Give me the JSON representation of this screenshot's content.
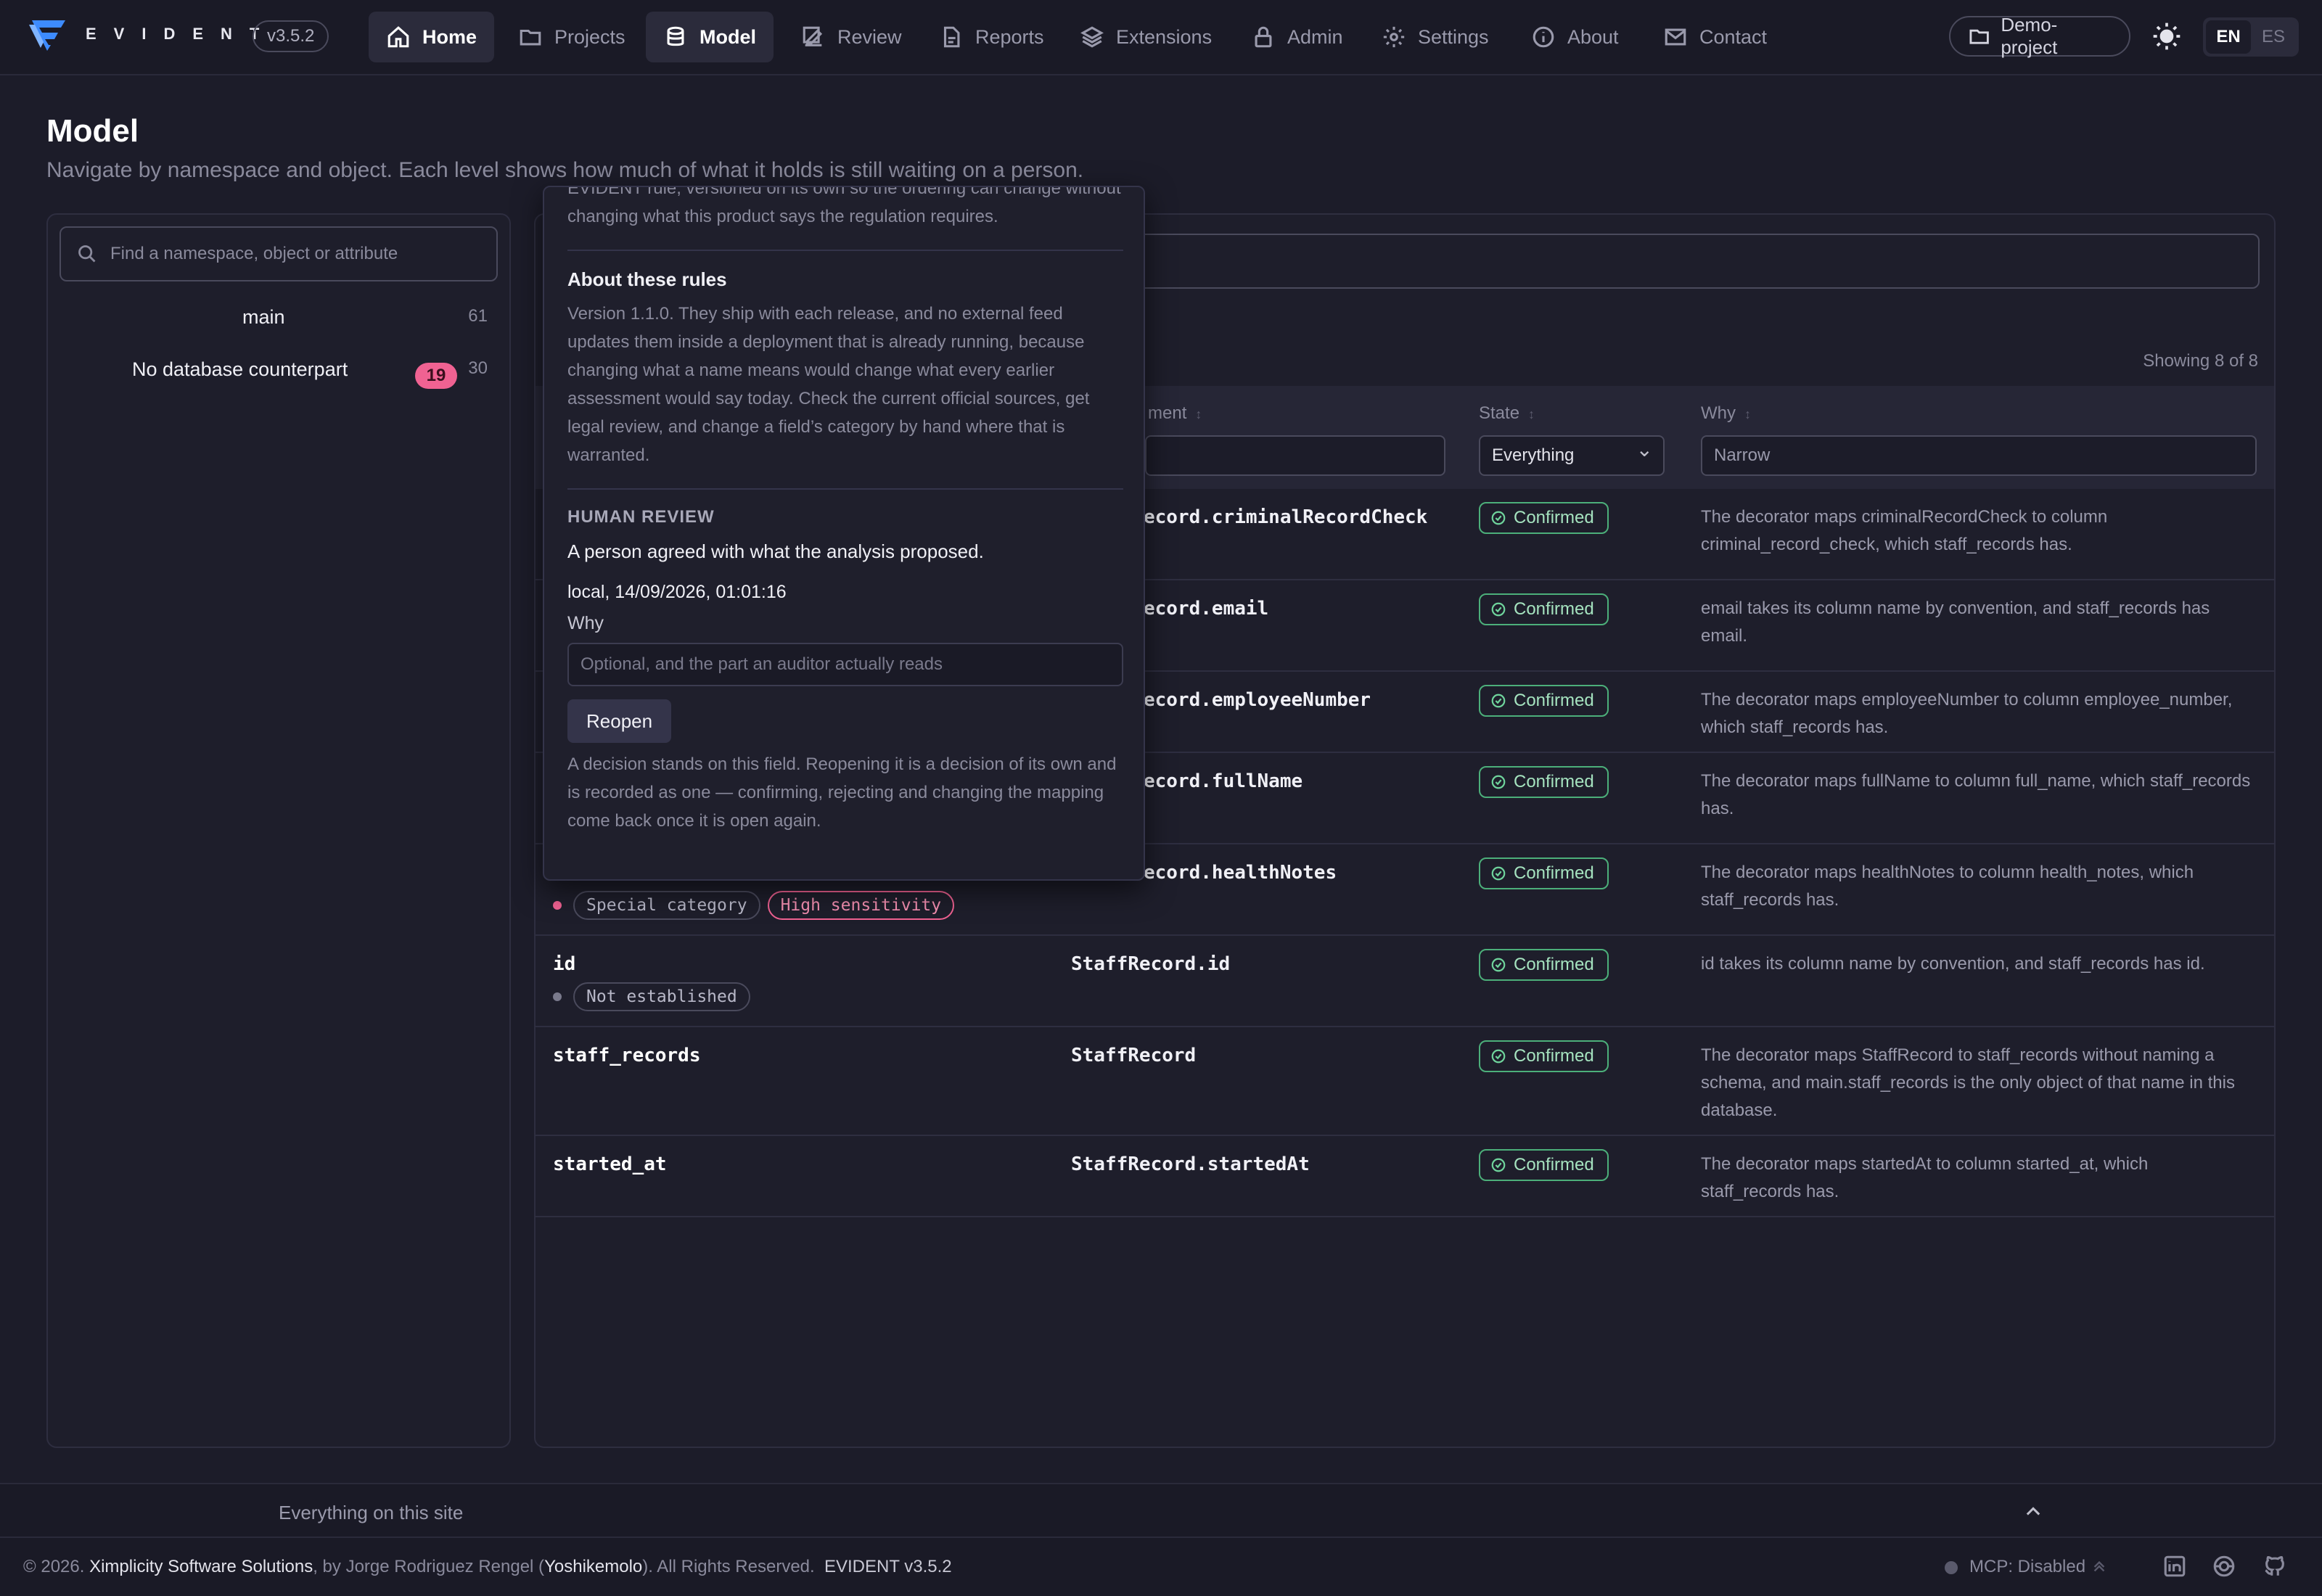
{
  "app": {
    "brand": "EVIDENT",
    "version": "v3.5.2",
    "project": "Demo-project",
    "languages": [
      "EN",
      "ES"
    ],
    "active_language": "EN"
  },
  "nav": [
    {
      "label": "Home",
      "icon": "home-icon"
    },
    {
      "label": "Projects",
      "icon": "folder-icon"
    },
    {
      "label": "Model",
      "icon": "database-icon",
      "active": true
    },
    {
      "label": "Review",
      "icon": "edit-icon"
    },
    {
      "label": "Reports",
      "icon": "report-icon"
    },
    {
      "label": "Extensions",
      "icon": "layers-icon"
    },
    {
      "label": "Admin",
      "icon": "lock-icon"
    },
    {
      "label": "Settings",
      "icon": "gear-icon"
    },
    {
      "label": "About",
      "icon": "info-icon"
    },
    {
      "label": "Contact",
      "icon": "mail-icon"
    }
  ],
  "page": {
    "title": "Model",
    "subtitle": "Navigate by namespace and object. Each level shows how much of what it holds is still waiting on a person."
  },
  "sidebar": {
    "search_placeholder": "Find a namespace, object or attribute",
    "tree": [
      {
        "label": "main",
        "count": "61"
      },
      {
        "label": "No database counterpart",
        "pending": "19",
        "count": "30"
      }
    ]
  },
  "table": {
    "showing": "Showing 8 of 8",
    "headers": {
      "element": "Element",
      "state": "State",
      "why": "Why"
    },
    "visible_header_element": "ment",
    "filter_state": "Everything",
    "filter_why_placeholder": "Narrow",
    "rows": [
      {
        "element": "StaffRecord.criminalRecordCheck",
        "visible_element": "ecord.criminalRecordCheck",
        "state": "Confirmed",
        "why": "The decorator maps criminalRecordCheck to column criminal_record_check, which staff_records has."
      },
      {
        "element": "StaffRecord.email",
        "visible_element": "ecord.email",
        "state": "Confirmed",
        "why": "email takes its column name by convention, and staff_records has email."
      },
      {
        "element": "StaffRecord.employeeNumber",
        "visible_element": "ecord.employeeNumber",
        "state": "Confirmed",
        "why": "The decorator maps employeeNumber to column employee_number, which staff_records has."
      },
      {
        "element": "StaffRecord.fullName",
        "visible_element": "ecord.fullName",
        "state": "Confirmed",
        "why": "The decorator maps fullName to column full_name, which staff_records has."
      },
      {
        "element": "StaffRecord.healthNotes",
        "visible_element": "ecord.healthNotes",
        "state": "Confirmed",
        "why": "The decorator maps healthNotes to column health_notes, which staff_records has.",
        "tags": [
          "Special category",
          "High sensitivity"
        ]
      },
      {
        "name": "id",
        "element": "StaffRecord.id",
        "state": "Confirmed",
        "why": "id takes its column name by convention, and staff_records has id.",
        "tags": [
          "Not established"
        ]
      },
      {
        "name": "staff_records",
        "element": "StaffRecord",
        "state": "Confirmed",
        "why": "The decorator maps StaffRecord to staff_records without naming a schema, and main.staff_records is the only object of that name in this database."
      },
      {
        "name": "started_at",
        "element": "StaffRecord.startedAt",
        "state": "Confirmed",
        "why": "The decorator maps startedAt to column started_at, which staff_records has."
      }
    ]
  },
  "popover": {
    "top_text": "EVIDENT rule, versioned on its own so the ordering can change without changing what this product says the regulation requires.",
    "rules_heading": "About these rules",
    "rules_text": "Version 1.1.0. They ship with each release, and no external feed updates them inside a deployment that is already running, because changing what a name means would change what every earlier assessment would say today. Check the current official sources, get legal review, and change a field’s category by hand where that is warranted.",
    "review_heading": "HUMAN REVIEW",
    "review_summary": "A person agreed with what the analysis proposed.",
    "review_meta": "local, 14/09/2026, 01:01:16",
    "why_label": "Why",
    "why_placeholder": "Optional, and the part an auditor actually reads",
    "reopen_label": "Reopen",
    "reopen_note": "A decision stands on this field. Reopening it is a decision of its own and is recorded as one — confirming, rejecting and changing the mapping come back once it is open again."
  },
  "footer": {
    "section_label": "Everything on this site",
    "copyright_prefix": "© 2026.",
    "company": "Ximplicity Software Solutions",
    "by_text": ", by Jorge Rodriguez Rengel (",
    "handle": "Yoshikemolo",
    "rights": "). All Rights Reserved.",
    "version": "EVIDENT v3.5.2",
    "mcp": "MCP: Disabled"
  },
  "colors": {
    "background": "#1c1c29",
    "confirmed": "#4caf7a",
    "pending_badge": "#f06292",
    "accent_logo": "#3d8bfd"
  }
}
